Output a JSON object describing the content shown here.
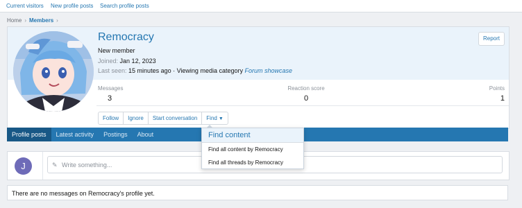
{
  "subnav": {
    "items": [
      "Current visitors",
      "New profile posts",
      "Search profile posts"
    ]
  },
  "breadcrumb": [
    "Home",
    "Members"
  ],
  "profile": {
    "username": "Remocracy",
    "user_title": "New member",
    "joined_label": "Joined:",
    "joined_value": "Jan 12, 2023",
    "last_seen_label": "Last seen:",
    "last_seen_value": "15 minutes ago · Viewing media category",
    "last_seen_link": "Forum showcase",
    "report_label": "Report",
    "stats": {
      "messages_label": "Messages",
      "messages_value": "3",
      "reaction_label": "Reaction score",
      "reaction_value": "0",
      "points_label": "Points",
      "points_value": "1"
    },
    "buttons": {
      "follow": "Follow",
      "ignore": "Ignore",
      "start_conversation": "Start conversation",
      "find": "Find"
    }
  },
  "tabs": [
    "Profile posts",
    "Latest activity",
    "Postings",
    "About"
  ],
  "find_menu": {
    "title": "Find content",
    "items": [
      "Find all content by Remocracy",
      "Find all threads by Remocracy"
    ]
  },
  "post_box": {
    "avatar_letter": "J",
    "placeholder": "Write something..."
  },
  "empty_message": "There are no messages on Remocracy's profile yet.",
  "colors": {
    "accent": "#2577b1",
    "tab_active": "#185886",
    "header_bg": "#eaf3fb",
    "avatar_bg": "#6e6bb8"
  }
}
